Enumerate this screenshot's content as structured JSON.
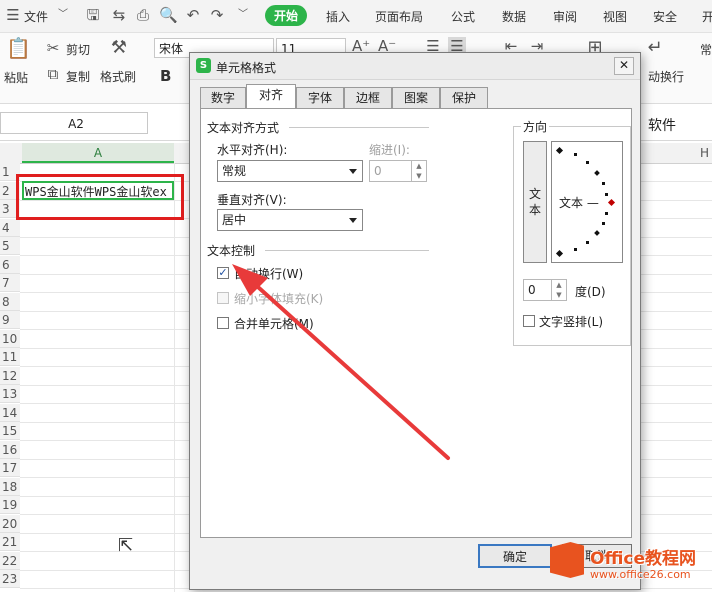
{
  "menubar": {
    "file_label": "文件",
    "items": [
      "开始",
      "插入",
      "页面布局",
      "公式",
      "数据",
      "审阅",
      "视图",
      "安全",
      "开"
    ]
  },
  "toolbar": {
    "paste_label": "粘贴",
    "cut_label": "剪切",
    "copy_label": "复制",
    "format_painter_label": "格式刷",
    "font_name": "宋体",
    "font_size": "11",
    "bold_label": "B",
    "wrap_label": "动换行",
    "right_clip": "常"
  },
  "formula_bar": {
    "name_box": "A2",
    "content_tail": "软件"
  },
  "sheet": {
    "column_a": "A",
    "column_h": "H",
    "rows": [
      "1",
      "2",
      "3",
      "4",
      "5",
      "6",
      "7",
      "8",
      "9",
      "10",
      "11",
      "12",
      "13",
      "14",
      "15",
      "16",
      "17",
      "18",
      "19",
      "20",
      "21",
      "22",
      "23"
    ],
    "cell_a2": "WPS金山软件WPS金山软ex"
  },
  "dialog": {
    "title": "单元格格式",
    "tabs": [
      "数字",
      "对齐",
      "字体",
      "边框",
      "图案",
      "保护"
    ],
    "active_tab": "对齐",
    "text_align_section": "文本对齐方式",
    "horizontal_label": "水平对齐(H):",
    "horizontal_value": "常规",
    "indent_label": "缩进(I):",
    "indent_value": "0",
    "vertical_label": "垂直对齐(V):",
    "vertical_value": "居中",
    "text_control_section": "文本控制",
    "wrap_text_label": "自动换行(W)",
    "wrap_text_checked": true,
    "shrink_label": "缩小字体填充(K)",
    "merge_label": "合并单元格(M)",
    "orientation_section": "方向",
    "vertical_text_box": "文本",
    "orientation_text": "文本 —",
    "degree_value": "0",
    "degree_label": "度(D)",
    "stacked_label": "文字竖排(L)",
    "ok_label": "确定",
    "cancel_label": "取消"
  },
  "watermark": {
    "brand": "Office教程网",
    "url": "www.office26.com"
  },
  "colors": {
    "accent_green": "#2db44a",
    "highlight_red": "#e01e1e",
    "brand_orange": "#e8531f",
    "arrow_red": "#e83a3a"
  }
}
